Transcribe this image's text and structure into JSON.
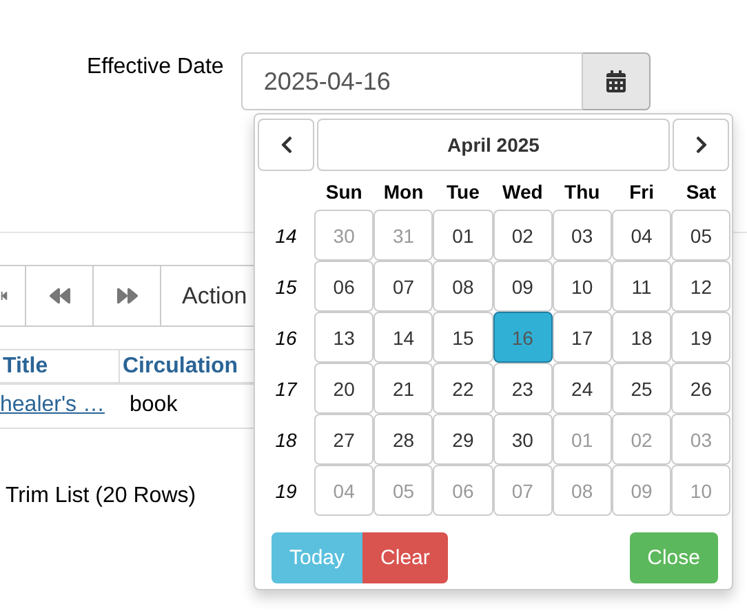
{
  "field": {
    "label": "Effective Date",
    "value": "2025-04-16"
  },
  "toolbar": {
    "items": [
      {
        "kind": "step-back"
      },
      {
        "kind": "back"
      },
      {
        "kind": "forward"
      },
      {
        "kind": "text",
        "label": "Action"
      }
    ]
  },
  "table": {
    "columns": [
      "Title",
      "Circulation"
    ],
    "rows": [
      {
        "title": "healer's …",
        "type": "book"
      }
    ]
  },
  "trim_link": "Trim List (20 Rows)",
  "calendar": {
    "title": "April 2025",
    "weekdays": [
      "Sun",
      "Mon",
      "Tue",
      "Wed",
      "Thu",
      "Fri",
      "Sat"
    ],
    "weeks": [
      {
        "number": "14",
        "days": [
          {
            "label": "30",
            "muted": true,
            "selected": false
          },
          {
            "label": "31",
            "muted": true,
            "selected": false
          },
          {
            "label": "01",
            "muted": false,
            "selected": false
          },
          {
            "label": "02",
            "muted": false,
            "selected": false
          },
          {
            "label": "03",
            "muted": false,
            "selected": false
          },
          {
            "label": "04",
            "muted": false,
            "selected": false
          },
          {
            "label": "05",
            "muted": false,
            "selected": false
          }
        ]
      },
      {
        "number": "15",
        "days": [
          {
            "label": "06",
            "muted": false,
            "selected": false
          },
          {
            "label": "07",
            "muted": false,
            "selected": false
          },
          {
            "label": "08",
            "muted": false,
            "selected": false
          },
          {
            "label": "09",
            "muted": false,
            "selected": false
          },
          {
            "label": "10",
            "muted": false,
            "selected": false
          },
          {
            "label": "11",
            "muted": false,
            "selected": false
          },
          {
            "label": "12",
            "muted": false,
            "selected": false
          }
        ]
      },
      {
        "number": "16",
        "days": [
          {
            "label": "13",
            "muted": false,
            "selected": false
          },
          {
            "label": "14",
            "muted": false,
            "selected": false
          },
          {
            "label": "15",
            "muted": false,
            "selected": false
          },
          {
            "label": "16",
            "muted": false,
            "selected": true
          },
          {
            "label": "17",
            "muted": false,
            "selected": false
          },
          {
            "label": "18",
            "muted": false,
            "selected": false
          },
          {
            "label": "19",
            "muted": false,
            "selected": false
          }
        ]
      },
      {
        "number": "17",
        "days": [
          {
            "label": "20",
            "muted": false,
            "selected": false
          },
          {
            "label": "21",
            "muted": false,
            "selected": false
          },
          {
            "label": "22",
            "muted": false,
            "selected": false
          },
          {
            "label": "23",
            "muted": false,
            "selected": false
          },
          {
            "label": "24",
            "muted": false,
            "selected": false
          },
          {
            "label": "25",
            "muted": false,
            "selected": false
          },
          {
            "label": "26",
            "muted": false,
            "selected": false
          }
        ]
      },
      {
        "number": "18",
        "days": [
          {
            "label": "27",
            "muted": false,
            "selected": false
          },
          {
            "label": "28",
            "muted": false,
            "selected": false
          },
          {
            "label": "29",
            "muted": false,
            "selected": false
          },
          {
            "label": "30",
            "muted": false,
            "selected": false
          },
          {
            "label": "01",
            "muted": true,
            "selected": false
          },
          {
            "label": "02",
            "muted": true,
            "selected": false
          },
          {
            "label": "03",
            "muted": true,
            "selected": false
          }
        ]
      },
      {
        "number": "19",
        "days": [
          {
            "label": "04",
            "muted": true,
            "selected": false
          },
          {
            "label": "05",
            "muted": true,
            "selected": false
          },
          {
            "label": "06",
            "muted": true,
            "selected": false
          },
          {
            "label": "07",
            "muted": true,
            "selected": false
          },
          {
            "label": "08",
            "muted": true,
            "selected": false
          },
          {
            "label": "09",
            "muted": true,
            "selected": false
          },
          {
            "label": "10",
            "muted": true,
            "selected": false
          }
        ]
      }
    ],
    "buttons": [
      {
        "kind": "today",
        "label": "Today"
      },
      {
        "kind": "clear",
        "label": "Clear"
      },
      {
        "kind": "close",
        "label": "Close"
      }
    ]
  }
}
